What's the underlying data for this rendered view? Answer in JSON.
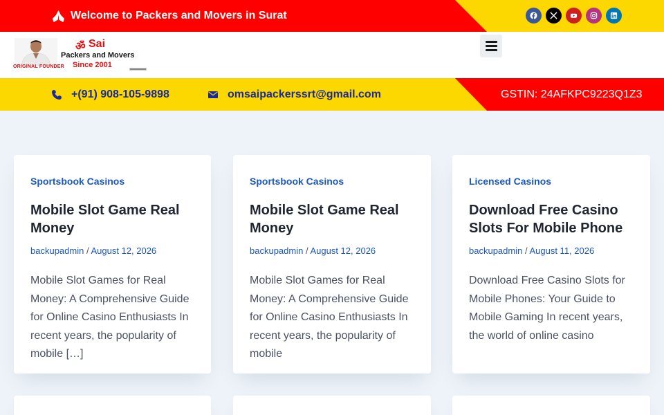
{
  "topbar": {
    "welcome_text": "Welcome to Packers and Movers in Surat",
    "social": [
      {
        "icon": "facebook-icon",
        "color": "#3b5998"
      },
      {
        "icon": "x-twitter-icon",
        "color": "#000000"
      },
      {
        "icon": "youtube-icon",
        "color": "#cd201f"
      },
      {
        "icon": "instagram-icon",
        "color": "#b5347f"
      },
      {
        "icon": "linkedin-icon",
        "color": "#0077b5"
      }
    ]
  },
  "header": {
    "logo": {
      "om": "ॐ",
      "brand": "Sai",
      "tagline": "Packers and Movers",
      "since": "Since 2001",
      "founder": "ORIGINAL FOUNDER"
    }
  },
  "contact": {
    "phone": "+(91) 908-105-9898",
    "email": "omsaipackerssrt@gmail.com",
    "gstin": "GSTIN: 24AFKPC9223Q1Z3"
  },
  "posts": [
    {
      "category": "Sportsbook Casinos",
      "title": "Mobile Slot Game Real Money",
      "author": "backupadmin",
      "date": "August 12, 2026",
      "excerpt": "Mobile Slot Games for Real Money: A Comprehensive Guide for Online Casino Enthusiasts In recent years, the popularity of mobile […]"
    },
    {
      "category": "Sportsbook Casinos",
      "title": "Mobile Slot Game Real Money",
      "author": "backupadmin",
      "date": "August 12, 2026",
      "excerpt": "Mobile Slot Games for Real Money: A Comprehensive Guide for Online Casino Enthusiasts In recent years, the popularity of mobile"
    },
    {
      "category": "Licensed Casinos",
      "title": "Download Free Casino Slots For Mobile Phone",
      "author": "backupadmin",
      "date": "August 11, 2026",
      "excerpt": "Download Free Casino Slots for Mobile Phones: Your Guide to Mobile Gaming In recent years, the world of online casino"
    }
  ],
  "colors": {
    "accent_red": "#ff0000",
    "accent_yellow": "#fdd700",
    "link_blue": "#1b57c2",
    "contact_blue": "#1b2a9c"
  }
}
